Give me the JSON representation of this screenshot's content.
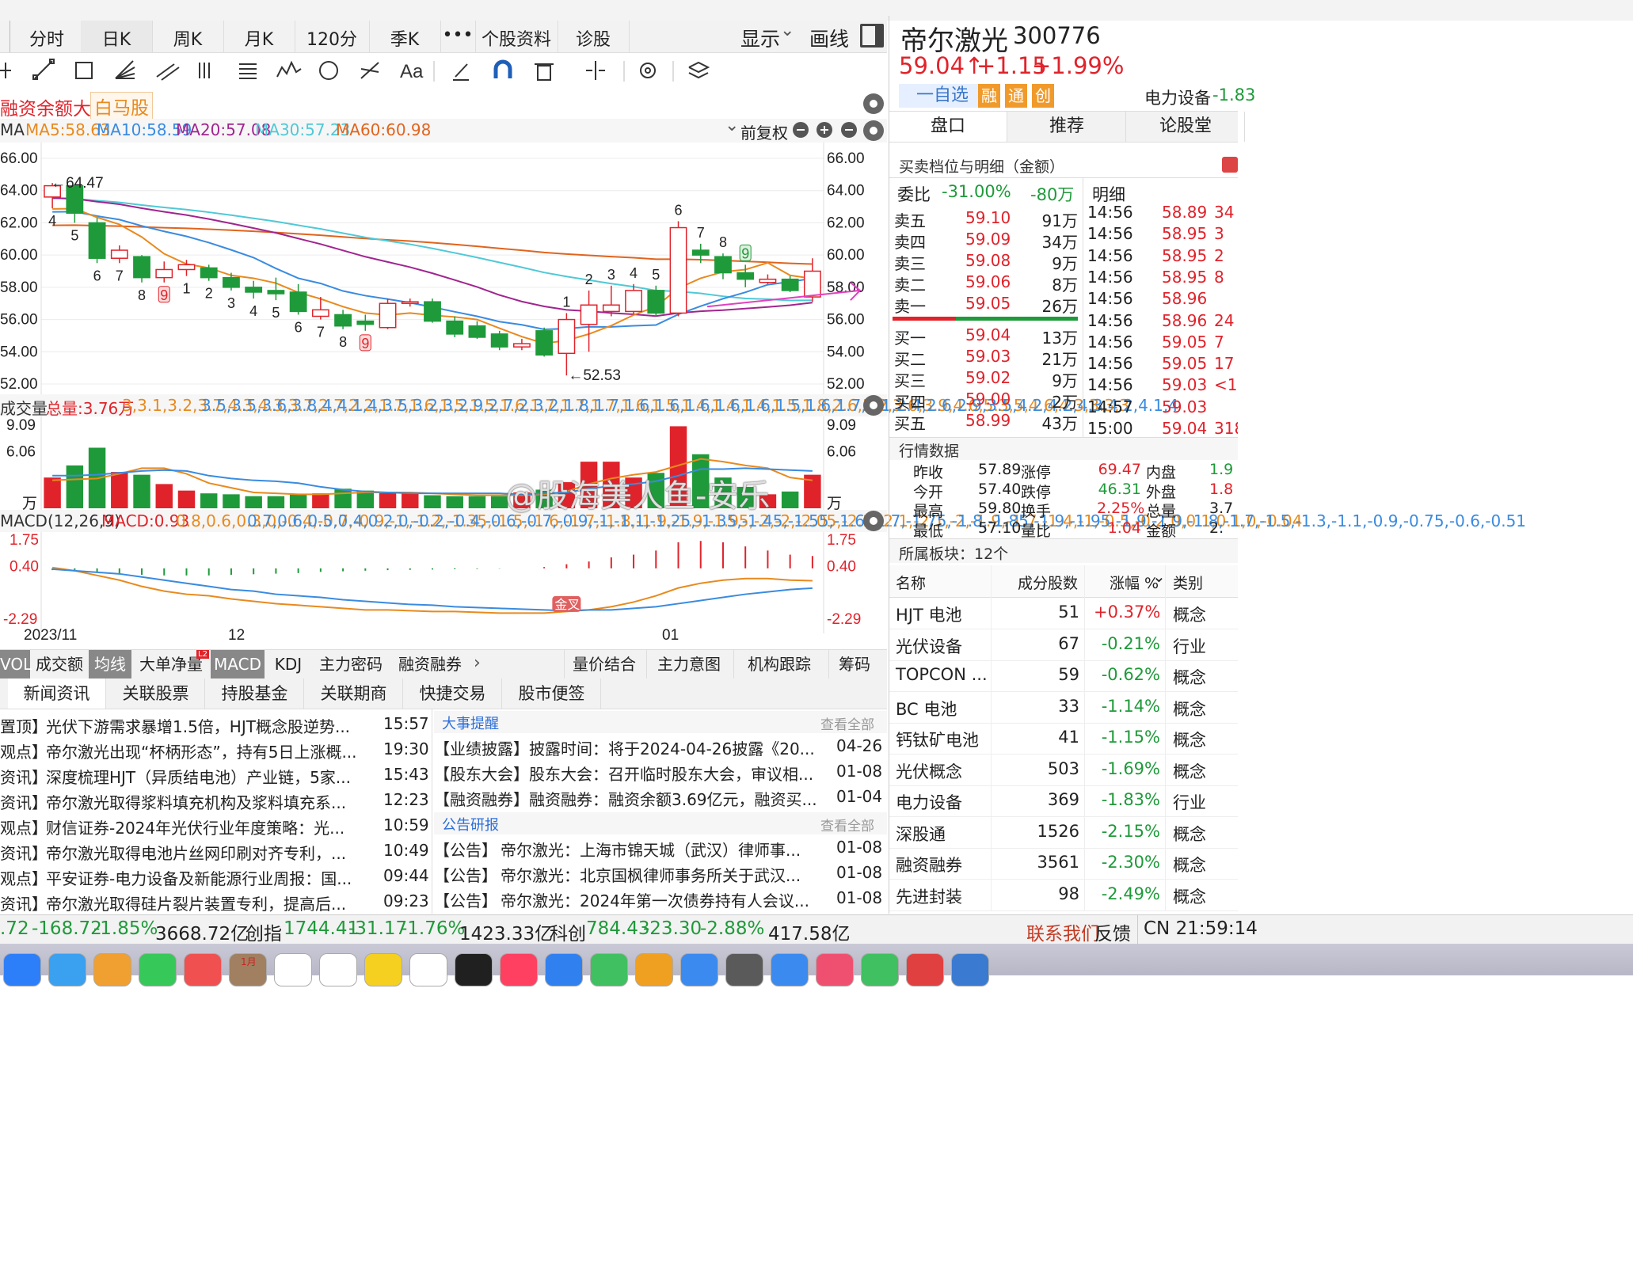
{
  "toolbar": {
    "tabs": [
      "分时",
      "日K",
      "周K",
      "月K",
      "120分",
      "季K",
      "•••",
      "个股资料",
      "诊股"
    ],
    "display": "显示",
    "draw": "画线"
  },
  "tags": {
    "t1": "融资余额大增",
    "t2": "白马股"
  },
  "ma_legend": {
    "label": "MA",
    "ma5": "MA5:58.63",
    "ma10": "MA10:58.59",
    "ma20": "MA20:57.08",
    "ma30": "MA30:57.23",
    "ma60": "MA60:60.98",
    "adjust": "前复权"
  },
  "price_axis": [
    "66.00",
    "64.00",
    "62.00",
    "60.00",
    "58.00",
    "56.00",
    "54.00",
    "52.00"
  ],
  "annotations": {
    "high": "←64.47",
    "low": "←52.53",
    "golden": "金叉"
  },
  "candles": [
    {
      "o": 63.6,
      "c": 64.3,
      "h": 64.47,
      "l": 62.9
    },
    {
      "o": 64.3,
      "c": 62.6,
      "h": 64.4,
      "l": 62.0
    },
    {
      "o": 62.0,
      "c": 59.8,
      "h": 62.3,
      "l": 59.5
    },
    {
      "o": 59.8,
      "c": 60.3,
      "h": 60.6,
      "l": 59.5
    },
    {
      "o": 59.9,
      "c": 58.6,
      "h": 60.0,
      "l": 58.3
    },
    {
      "o": 58.6,
      "c": 59.1,
      "h": 59.6,
      "l": 58.3
    },
    {
      "o": 59.1,
      "c": 59.4,
      "h": 59.7,
      "l": 58.7
    },
    {
      "o": 59.2,
      "c": 58.6,
      "h": 59.4,
      "l": 58.4
    },
    {
      "o": 58.6,
      "c": 58.0,
      "h": 58.9,
      "l": 57.8
    },
    {
      "o": 58.0,
      "c": 57.7,
      "h": 58.4,
      "l": 57.3
    },
    {
      "o": 57.8,
      "c": 57.6,
      "h": 58.6,
      "l": 57.2
    },
    {
      "o": 57.7,
      "c": 56.5,
      "h": 58.2,
      "l": 56.3
    },
    {
      "o": 56.2,
      "c": 56.6,
      "h": 57.4,
      "l": 56.0
    },
    {
      "o": 56.3,
      "c": 55.6,
      "h": 56.6,
      "l": 55.4
    },
    {
      "o": 55.9,
      "c": 55.7,
      "h": 56.3,
      "l": 55.3
    },
    {
      "o": 55.5,
      "c": 57.0,
      "h": 57.3,
      "l": 55.4
    },
    {
      "o": 57.0,
      "c": 57.1,
      "h": 57.3,
      "l": 56.8
    },
    {
      "o": 57.1,
      "c": 55.9,
      "h": 57.3,
      "l": 55.8
    },
    {
      "o": 55.9,
      "c": 55.1,
      "h": 56.2,
      "l": 54.9
    },
    {
      "o": 55.6,
      "c": 54.9,
      "h": 55.9,
      "l": 54.8
    },
    {
      "o": 55.1,
      "c": 54.3,
      "h": 55.3,
      "l": 54.1
    },
    {
      "o": 54.3,
      "c": 54.5,
      "h": 54.8,
      "l": 54.1
    },
    {
      "o": 55.3,
      "c": 53.8,
      "h": 55.5,
      "l": 53.7
    },
    {
      "o": 53.9,
      "c": 56.0,
      "h": 56.4,
      "l": 52.53
    },
    {
      "o": 55.7,
      "c": 56.9,
      "h": 57.8,
      "l": 54.0
    },
    {
      "o": 56.5,
      "c": 56.9,
      "h": 58.1,
      "l": 56.2
    },
    {
      "o": 56.5,
      "c": 57.8,
      "h": 58.2,
      "l": 56.3
    },
    {
      "o": 57.8,
      "c": 56.4,
      "h": 58.1,
      "l": 56.2
    },
    {
      "o": 56.4,
      "c": 61.7,
      "h": 62.1,
      "l": 56.2
    },
    {
      "o": 60.3,
      "c": 60.0,
      "h": 60.7,
      "l": 59.5
    },
    {
      "o": 59.9,
      "c": 58.9,
      "h": 60.1,
      "l": 58.5
    },
    {
      "o": 58.9,
      "c": 58.5,
      "h": 59.4,
      "l": 58.0
    },
    {
      "o": 58.3,
      "c": 58.5,
      "h": 58.8,
      "l": 58.2
    },
    {
      "o": 58.5,
      "c": 57.8,
      "h": 58.7,
      "l": 57.7
    },
    {
      "o": 57.4,
      "c": 59.0,
      "h": 59.8,
      "l": 57.1
    }
  ],
  "candle_counts": [
    {
      "i": 0,
      "n": "4",
      "pos": "below"
    },
    {
      "i": 1,
      "n": "5",
      "pos": "below"
    },
    {
      "i": 2,
      "n": "6",
      "pos": "below"
    },
    {
      "i": 3,
      "n": "7",
      "pos": "below"
    },
    {
      "i": 4,
      "n": "8",
      "pos": "below"
    },
    {
      "i": 5,
      "n": "9",
      "pos": "below",
      "box": true
    },
    {
      "i": 6,
      "n": "1",
      "pos": "below"
    },
    {
      "i": 7,
      "n": "2",
      "pos": "below"
    },
    {
      "i": 8,
      "n": "3",
      "pos": "below"
    },
    {
      "i": 9,
      "n": "4",
      "pos": "below"
    },
    {
      "i": 10,
      "n": "5",
      "pos": "below"
    },
    {
      "i": 11,
      "n": "6",
      "pos": "below"
    },
    {
      "i": 12,
      "n": "7",
      "pos": "below"
    },
    {
      "i": 13,
      "n": "8",
      "pos": "below"
    },
    {
      "i": 14,
      "n": "9",
      "pos": "below",
      "box": true
    },
    {
      "i": 23,
      "n": "1",
      "pos": "above"
    },
    {
      "i": 24,
      "n": "2",
      "pos": "above"
    },
    {
      "i": 25,
      "n": "3",
      "pos": "above"
    },
    {
      "i": 26,
      "n": "4",
      "pos": "above"
    },
    {
      "i": 27,
      "n": "5",
      "pos": "above"
    },
    {
      "i": 28,
      "n": "6",
      "pos": "above"
    },
    {
      "i": 29,
      "n": "7",
      "pos": "above"
    },
    {
      "i": 30,
      "n": "8",
      "pos": "above"
    },
    {
      "i": 31,
      "n": "9",
      "pos": "above",
      "box": true
    }
  ],
  "volume": {
    "label": "成交量",
    "total": "总量:3.76万",
    "ma5": [
      3.0,
      3.1,
      3.2,
      3.7,
      4.3,
      4.3,
      3.7,
      2.7,
      2.2,
      1.7,
      1.6,
      1.5,
      1.5,
      1.6,
      1.7,
      1.7,
      1.7,
      1.6,
      1.5,
      1.4,
      1.4,
      1.4,
      1.5,
      1.8,
      2.6,
      3.2,
      3.6,
      3.9,
      4.6,
      5.3,
      5.0,
      4.6,
      4.3,
      3.3,
      3.0
    ],
    "ma10": [
      3.5,
      3.5,
      3.6,
      3.8,
      4.0,
      4.1,
      4.0,
      3.5,
      3.2,
      3.0,
      2.9,
      2.7,
      2.3,
      2.0,
      1.8,
      1.7,
      1.6,
      1.6,
      1.6,
      1.6,
      1.6,
      1.5,
      1.6,
      1.7,
      2.1,
      2.4,
      2.6,
      2.9,
      3.5,
      4.2,
      4.2,
      4.3,
      4.2,
      4.1,
      4.0
    ],
    "axis_top": "9.09",
    "axis_mid": "6.06",
    "unit": "万",
    "values": [
      3.3,
      4.6,
      6.5,
      3.9,
      3.6,
      2.6,
      1.9,
      1.6,
      1.5,
      1.3,
      1.3,
      1.5,
      1.6,
      2.1,
      1.9,
      1.7,
      1.6,
      1.4,
      1.3,
      1.3,
      1.3,
      1.7,
      2.0,
      2.8,
      5.0,
      5.0,
      3.3,
      3.8,
      8.8,
      5.8,
      3.3,
      2.3,
      1.5,
      1.8,
      3.6
    ]
  },
  "macd": {
    "label": "MACD(12,26,9)",
    "macd": "MACD:0.93",
    "diff": [
      0.8,
      0.6,
      0.3,
      0.0,
      -0.4,
      -0.7,
      -0.9,
      -1.0,
      -1.2,
      -1.35,
      -1.5,
      -1.6,
      -1.7,
      -1.8,
      -1.9,
      -1.9,
      -1.95,
      -2.0,
      -2.0,
      -2.05,
      -2.1,
      -2.1,
      -2.1,
      -2.0,
      -1.9,
      -1.7,
      -1.4,
      -1.0,
      -0.5,
      -0.2,
      0.0,
      0.1,
      0.1,
      0.0,
      -0.04
    ],
    "dea": [
      0.7,
      0.6,
      0.5,
      0.4,
      0.2,
      0.0,
      -0.2,
      -0.4,
      -0.6,
      -0.7,
      -0.9,
      -1.0,
      -1.1,
      -1.25,
      -1.35,
      -1.45,
      -1.55,
      -1.6,
      -1.7,
      -1.75,
      -1.8,
      -1.85,
      -1.9,
      -1.95,
      -1.9,
      -1.9,
      -1.8,
      -1.7,
      -1.5,
      -1.3,
      -1.1,
      -0.9,
      -0.75,
      -0.6,
      -0.51
    ],
    "axis": [
      "1.75",
      "0.40",
      "-2.29"
    ],
    "hist": [
      -0.3,
      -0.5,
      -0.7,
      -0.9,
      -1.1,
      -1.2,
      -1.2,
      -1.2,
      -1.1,
      -1.0,
      -0.9,
      -0.8,
      -0.6,
      -0.5,
      -0.4,
      -0.3,
      -0.25,
      -0.2,
      -0.15,
      -0.1,
      -0.05,
      0.0,
      0.1,
      0.3,
      0.5,
      0.8,
      1.0,
      1.3,
      1.9,
      2.0,
      1.9,
      1.6,
      1.3,
      1.0,
      0.9
    ]
  },
  "dates": [
    "2023/11",
    "12",
    "01"
  ],
  "indicator_tabs": [
    "VOL",
    "成交额",
    "均线",
    "大单净量",
    "MACD",
    "KDJ",
    "主力密码",
    "融资融券"
  ],
  "indicator_right": [
    "量价结合",
    "主力意图",
    "机构跟踪",
    "筹码"
  ],
  "l2": "L2",
  "news_tabs": [
    "新闻资讯",
    "关联股票",
    "持股基金",
    "关联期商",
    "快捷交易",
    "股市便签"
  ],
  "news": [
    {
      "tag": "置顶】",
      "title": "光伏下游需求暴增1.5倍，HJT概念股逆势...",
      "time": "15:57"
    },
    {
      "tag": "观点】",
      "title": "帝尔激光出现“杯柄形态”，持有5日上涨概...",
      "time": "19:30"
    },
    {
      "tag": "资讯】",
      "title": "深度梳理HJT（异质结电池）产业链，5家...",
      "time": "15:43"
    },
    {
      "tag": "资讯】",
      "title": "帝尔激光取得浆料填充机构及浆料填充系...",
      "time": "12:23"
    },
    {
      "tag": "观点】",
      "title": "财信证券-2024年光伏行业年度策略：光...",
      "time": "10:59"
    },
    {
      "tag": "资讯】",
      "title": "帝尔激光取得电池片丝网印刷对齐专利，...",
      "time": "10:49"
    },
    {
      "tag": "观点】",
      "title": "平安证券-电力设备及新能源行业周报：国...",
      "time": "09:44"
    },
    {
      "tag": "资讯】",
      "title": "帝尔激光取得硅片裂片装置专利，提高后...",
      "time": "09:23"
    }
  ],
  "events": {
    "title": "大事提醒",
    "more": "查看全部",
    "items": [
      {
        "tag": "【业绩披露】",
        "title": "披露时间：将于2024-04-26披露《20...",
        "date": "04-26"
      },
      {
        "tag": "【股东大会】",
        "title": "股东大会：召开临时股东大会，审议相...",
        "date": "01-08"
      },
      {
        "tag": "【融资融券】",
        "title": "融资融券：融资余额3.69亿元，融资买...",
        "date": "01-04"
      }
    ]
  },
  "reports": {
    "title": "公告研报",
    "more": "查看全部",
    "items": [
      {
        "tag": "【公告】",
        "title": "帝尔激光：上海市锦天城（武汉）律师事...",
        "date": "01-08"
      },
      {
        "tag": "【公告】",
        "title": "帝尔激光：北京国枫律师事务所关于武汉...",
        "date": "01-08"
      },
      {
        "tag": "【公告】",
        "title": "帝尔激光：2024年第一次债券持有人会议...",
        "date": "01-08"
      }
    ]
  },
  "watermark": "@股海美人鱼-安乐",
  "stock": {
    "name": "帝尔激光",
    "code": "300776",
    "price": "59.04↑",
    "change": "+1.15",
    "pct": "+1.99%",
    "watch": "一自选",
    "b1": "融",
    "b2": "通",
    "b3": "创",
    "sector": "电力设备",
    "sector_pct": "-1.83"
  },
  "right_tabs": [
    "盘口",
    "推荐",
    "论股堂"
  ],
  "orderbook": {
    "title": "买卖档位与明细（金额）",
    "ratio_label": "委比",
    "ratio": "-31.00%",
    "diff": "-80万",
    "detail": "明细",
    "sells": [
      {
        "l": "卖五",
        "p": "59.10",
        "v": "91万"
      },
      {
        "l": "卖四",
        "p": "59.09",
        "v": "34万"
      },
      {
        "l": "卖三",
        "p": "59.08",
        "v": "9万"
      },
      {
        "l": "卖二",
        "p": "59.06",
        "v": "8万"
      },
      {
        "l": "卖一",
        "p": "59.05",
        "v": "26万"
      }
    ],
    "buys": [
      {
        "l": "买一",
        "p": "59.04",
        "v": "13万"
      },
      {
        "l": "买二",
        "p": "59.03",
        "v": "21万"
      },
      {
        "l": "买三",
        "p": "59.02",
        "v": "9万"
      },
      {
        "l": "买四",
        "p": "59.00",
        "v": "2万"
      },
      {
        "l": "买五",
        "p": "58.99",
        "v": "43万"
      }
    ]
  },
  "ticks": [
    {
      "t": "14:56",
      "p": "58.89",
      "v": "34"
    },
    {
      "t": "14:56",
      "p": "58.95",
      "v": "3"
    },
    {
      "t": "14:56",
      "p": "58.95",
      "v": "2"
    },
    {
      "t": "14:56",
      "p": "58.95",
      "v": "8"
    },
    {
      "t": "14:56",
      "p": "58.96",
      "v": ""
    },
    {
      "t": "14:56",
      "p": "58.96",
      "v": "24"
    },
    {
      "t": "14:56",
      "p": "59.05",
      "v": "7"
    },
    {
      "t": "14:56",
      "p": "59.05",
      "v": "17"
    },
    {
      "t": "14:56",
      "p": "59.03",
      "v": "<1"
    },
    {
      "t": "14:57",
      "p": "59.03",
      "v": ""
    },
    {
      "t": "15:00",
      "p": "59.04",
      "v": "318"
    }
  ],
  "quote": {
    "title": "行情数据",
    "rows": [
      {
        "a": "昨收",
        "av": "57.89",
        "b": "涨停",
        "bv": "69.47",
        "c": "内盘",
        "cv": "1.9"
      },
      {
        "a": "今开",
        "av": "57.40",
        "b": "跌停",
        "bv": "46.31",
        "c": "外盘",
        "cv": "1.8"
      },
      {
        "a": "最高",
        "av": "59.80",
        "b": "换手",
        "bv": "2.25%",
        "c": "总量",
        "cv": "3.7"
      },
      {
        "a": "最低",
        "av": "57.10",
        "b": "量比",
        "bv": "1.04",
        "c": "金额",
        "cv": "2."
      }
    ]
  },
  "sectors": {
    "title": "所属板块：12个",
    "headers": [
      "名称",
      "成分股数",
      "涨幅 %",
      "类别"
    ],
    "rows": [
      {
        "n": "HJT 电池",
        "c": "51",
        "p": "+0.37%",
        "k": "概念"
      },
      {
        "n": "光伏设备",
        "c": "67",
        "p": "-0.21%",
        "k": "行业"
      },
      {
        "n": "TOPCON ...",
        "c": "59",
        "p": "-0.62%",
        "k": "概念"
      },
      {
        "n": "BC 电池",
        "c": "33",
        "p": "-1.14%",
        "k": "概念"
      },
      {
        "n": "钙钛矿电池",
        "c": "41",
        "p": "-1.15%",
        "k": "概念"
      },
      {
        "n": "光伏概念",
        "c": "503",
        "p": "-1.69%",
        "k": "概念"
      },
      {
        "n": "电力设备",
        "c": "369",
        "p": "-1.83%",
        "k": "行业"
      },
      {
        "n": "深股通",
        "c": "1526",
        "p": "-2.15%",
        "k": "概念"
      },
      {
        "n": "融资融券",
        "c": "3561",
        "p": "-2.30%",
        "k": "概念"
      },
      {
        "n": "先进封装",
        "c": "98",
        "p": "-2.49%",
        "k": "概念"
      }
    ]
  },
  "status": {
    "s1": ".72",
    "s1b": "-168.72",
    "s1c": "-1.85%",
    "s1d": "3668.72亿",
    "cy": "创指",
    "cy1": "1744.41",
    "cy2": "-31.17",
    "cy3": "-1.76%",
    "cy4": "1423.33亿",
    "kc": "科创",
    "kc1": "784.43",
    "kc2": "-23.30",
    "kc3": "-2.88%",
    "kc4": "417.58亿",
    "contact": "联系我们",
    "feedback": "反馈",
    "clock": "CN 21:59:14"
  },
  "dock": {
    "cal_month": "1月"
  },
  "colors": {
    "up": "#e0232b",
    "down": "#1f9a3a",
    "ma5": "#e88a1e",
    "ma10": "#3a8be0",
    "ma20": "#a0258f",
    "ma30": "#4fc9d6",
    "ma60": "#e0641e"
  }
}
